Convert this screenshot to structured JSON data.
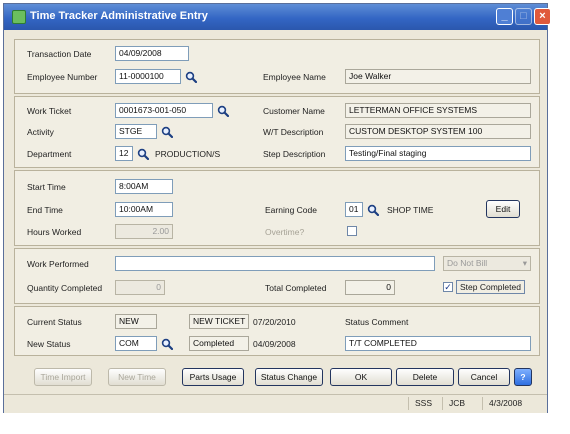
{
  "window": {
    "title": "Time Tracker Administrative Entry"
  },
  "transaction": {
    "date_label": "Transaction Date",
    "date_value": "04/09/2008",
    "employee_number_label": "Employee Number",
    "employee_number_value": "11-0000100",
    "employee_name_label": "Employee Name",
    "employee_name_value": "Joe Walker"
  },
  "work": {
    "ticket_label": "Work Ticket",
    "ticket_value": "0001673-001-050",
    "activity_label": "Activity",
    "activity_value": "STGE",
    "department_label": "Department",
    "department_code": "12",
    "department_name": "PRODUCTION/S",
    "customer_name_label": "Customer Name",
    "customer_name_value": "LETTERMAN OFFICE SYSTEMS",
    "wt_description_label": "W/T Description",
    "wt_description_value": "CUSTOM DESKTOP SYSTEM 100",
    "step_description_label": "Step Description",
    "step_description_value": "Testing/Final staging"
  },
  "time": {
    "start_label": "Start Time",
    "start_value": "8:00AM",
    "end_label": "End Time",
    "end_value": "10:00AM",
    "hours_label": "Hours Worked",
    "hours_value": "2.00",
    "earning_code_label": "Earning Code",
    "earning_code_value": "01",
    "earning_code_desc": "SHOP TIME",
    "edit_button": "Edit",
    "overtime_label": "Overtime?"
  },
  "performed": {
    "work_performed_label": "Work Performed",
    "work_performed_value": "",
    "select_value": "Do Not Bill",
    "qty_completed_label": "Quantity Completed",
    "qty_completed_value": "0",
    "total_completed_label": "Total Completed",
    "total_completed_value": "0",
    "step_completed_label": "Step Completed",
    "step_completed_checked": true
  },
  "status": {
    "current_label": "Current Status",
    "current_code": "NEW",
    "current_desc": "NEW TICKET",
    "current_date": "07/20/2010",
    "status_comment_label": "Status Comment",
    "new_label": "New Status",
    "new_code": "COM",
    "new_desc": "Completed",
    "new_date": "04/09/2008",
    "comment_value": "T/T COMPLETED"
  },
  "buttons": {
    "time_import": "Time Import",
    "new_time": "New Time",
    "parts_usage": "Parts Usage",
    "status_change": "Status Change",
    "ok": "OK",
    "delete": "Delete",
    "cancel": "Cancel",
    "help": "?"
  },
  "statusbar": {
    "company": "SSS",
    "module": "JCB",
    "date": "4/3/2008"
  },
  "colors": {
    "title_bar": "#3366c4",
    "accent": "#23355f",
    "window_bg": "#ece8da"
  }
}
